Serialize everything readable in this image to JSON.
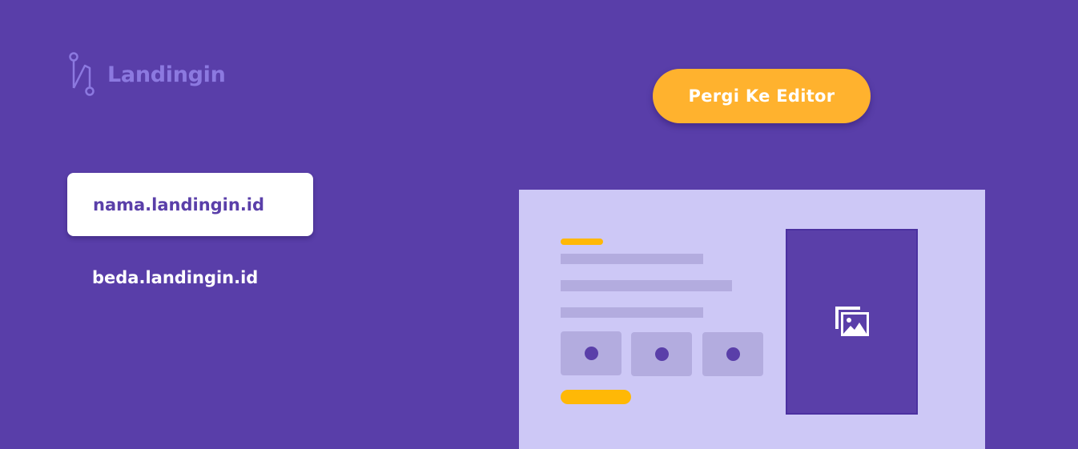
{
  "brand": {
    "name": "Landingin",
    "logo_icon": "landingin-logo-icon",
    "logo_color": "#8c79e0"
  },
  "header": {
    "cta_label": "Pergi Ke Editor",
    "cta_color": "#ffb22e"
  },
  "domains": {
    "selected": "nama.landingin.id",
    "other": "beda.landingin.id"
  },
  "mockup": {
    "image_icon": "image-gallery-icon",
    "background": "#cdc8f6",
    "accent": "#ffb806"
  },
  "colors": {
    "page_background": "#593ea9",
    "primary": "#5a3fa9"
  }
}
